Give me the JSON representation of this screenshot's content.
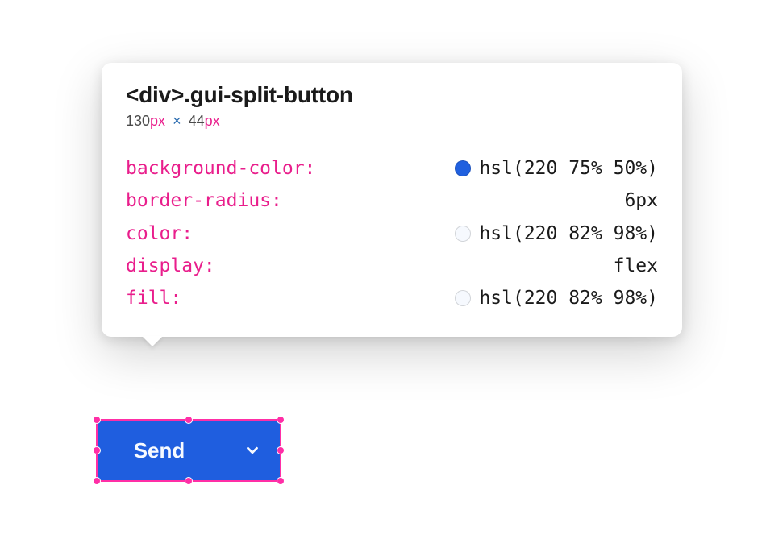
{
  "tooltip": {
    "selector": "<div>.gui-split-button",
    "width_value": "130",
    "width_unit": "px",
    "times": "×",
    "height_value": "44",
    "height_unit": "px",
    "props": [
      {
        "name": "background-color:",
        "value": "hsl(220 75% 50%)",
        "swatch": "#2060df"
      },
      {
        "name": "border-radius:",
        "value": "6px",
        "swatch": null
      },
      {
        "name": "color:",
        "value": "hsl(220 82% 98%)",
        "swatch": "#f6f9fe"
      },
      {
        "name": "display:",
        "value": "flex",
        "swatch": null
      },
      {
        "name": "fill:",
        "value": "hsl(220 82% 98%)",
        "swatch": "#f6f9fe"
      }
    ]
  },
  "button": {
    "main_label": "Send"
  }
}
